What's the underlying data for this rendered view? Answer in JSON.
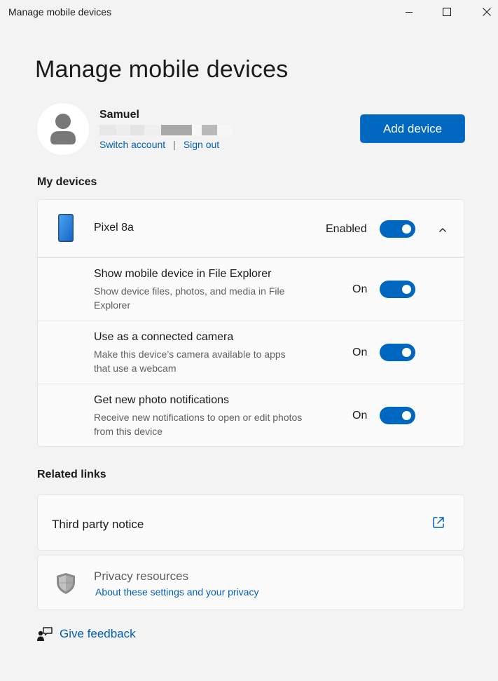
{
  "window": {
    "title": "Manage mobile devices"
  },
  "page": {
    "heading": "Manage mobile devices"
  },
  "account": {
    "name": "Samuel",
    "switch_label": "Switch account",
    "separator": "|",
    "signout_label": "Sign out",
    "add_device_label": "Add device"
  },
  "my_devices": {
    "heading": "My devices",
    "device": {
      "name": "Pixel 8a",
      "status_label": "Enabled",
      "enabled": true,
      "settings": [
        {
          "title": "Show mobile device in File Explorer",
          "description": "Show device files, photos, and media in File Explorer",
          "state_label": "On",
          "on": true
        },
        {
          "title": "Use as a connected camera",
          "description": "Make this device’s camera available to apps that use a webcam",
          "state_label": "On",
          "on": true
        },
        {
          "title": "Get new photo notifications",
          "description": "Receive new notifications to open or edit photos from this device",
          "state_label": "On",
          "on": true
        }
      ]
    }
  },
  "related_links": {
    "heading": "Related links",
    "third_party": "Third party notice",
    "privacy_title": "Privacy resources",
    "privacy_link": "About these settings and your privacy"
  },
  "feedback": {
    "label": "Give feedback"
  },
  "icons": {
    "minimize": "minimize-icon",
    "maximize": "maximize-icon",
    "close": "close-icon",
    "avatar": "person-icon",
    "phone": "phone-icon",
    "chevron": "chevron-up-icon",
    "external": "external-link-icon",
    "shield": "shield-icon",
    "feedback": "feedback-icon"
  },
  "colors": {
    "accent": "#0067c0",
    "link": "#005fb8",
    "background": "#f3f3f3",
    "card": "#fbfbfb"
  }
}
